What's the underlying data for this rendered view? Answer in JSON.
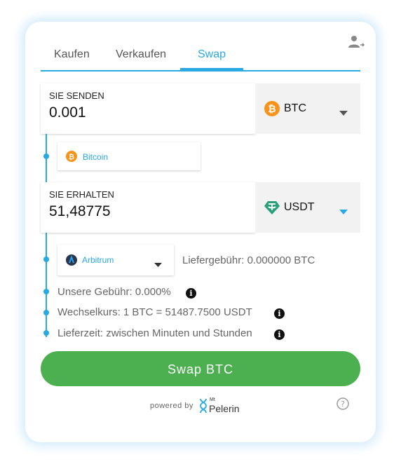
{
  "tabs": [
    {
      "label": "Kaufen",
      "active": false
    },
    {
      "label": "Verkaufen",
      "active": false
    },
    {
      "label": "Swap",
      "active": true
    }
  ],
  "send": {
    "label": "SIE SENDEN",
    "value": "0.001",
    "currency": "BTC",
    "network": "Bitcoin"
  },
  "receive": {
    "label": "SIE ERHALTEN",
    "value": "51,48775",
    "currency": "USDT",
    "network": "Arbitrum"
  },
  "delivery_fee": "Liefergebühr: 0.000000 BTC",
  "our_fee": "Unsere Gebühr: 0.000%",
  "exchange_rate": "Wechselkurs: 1 BTC = 51487.7500 USDT",
  "delivery_time": "Lieferzeit: zwischen Minuten und Stunden",
  "swap_button": "Swap BTC",
  "powered_by": "powered by",
  "brand": {
    "small": "Mt",
    "name": "Pelerin"
  },
  "icons": {
    "user": "user-switch-icon",
    "help": "help-icon",
    "info": "info-icon"
  },
  "colors": {
    "accent": "#29a9e1",
    "button": "#4caf50",
    "bitcoin": "#f7931a",
    "tether": "#26a17b"
  }
}
